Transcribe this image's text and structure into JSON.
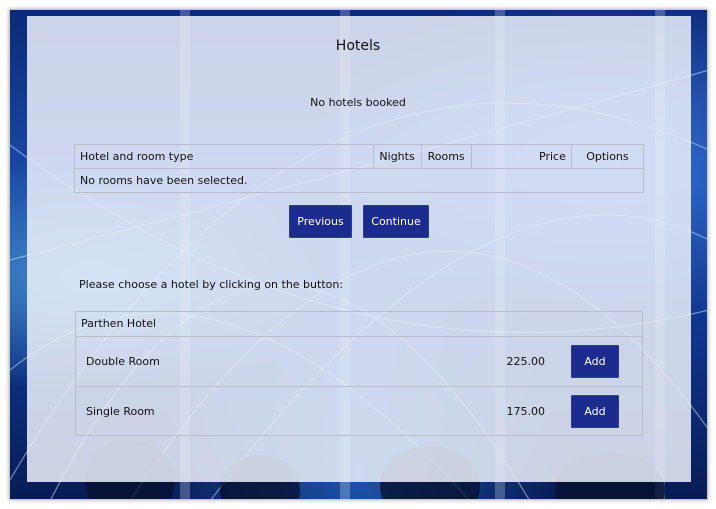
{
  "page": {
    "title": "Hotels",
    "booked_status": "No hotels booked"
  },
  "summary_table": {
    "headers": {
      "hotel_room": "Hotel and room type",
      "nights": "Nights",
      "rooms": "Rooms",
      "price": "Price",
      "options": "Options"
    },
    "empty_message": "No rooms have been selected."
  },
  "nav": {
    "previous_label": "Previous",
    "continue_label": "Continue"
  },
  "instructions": "Please choose a hotel by clicking on the button:",
  "hotels": [
    {
      "name": "Parthen Hotel",
      "rooms": [
        {
          "type": "Double Room",
          "price": "225.00",
          "action": "Add"
        },
        {
          "type": "Single Room",
          "price": "175.00",
          "action": "Add"
        }
      ]
    }
  ],
  "colors": {
    "button_bg": "#1c2c8e",
    "panel_bg": "#ecf0fa",
    "border": "#b9bccb"
  }
}
